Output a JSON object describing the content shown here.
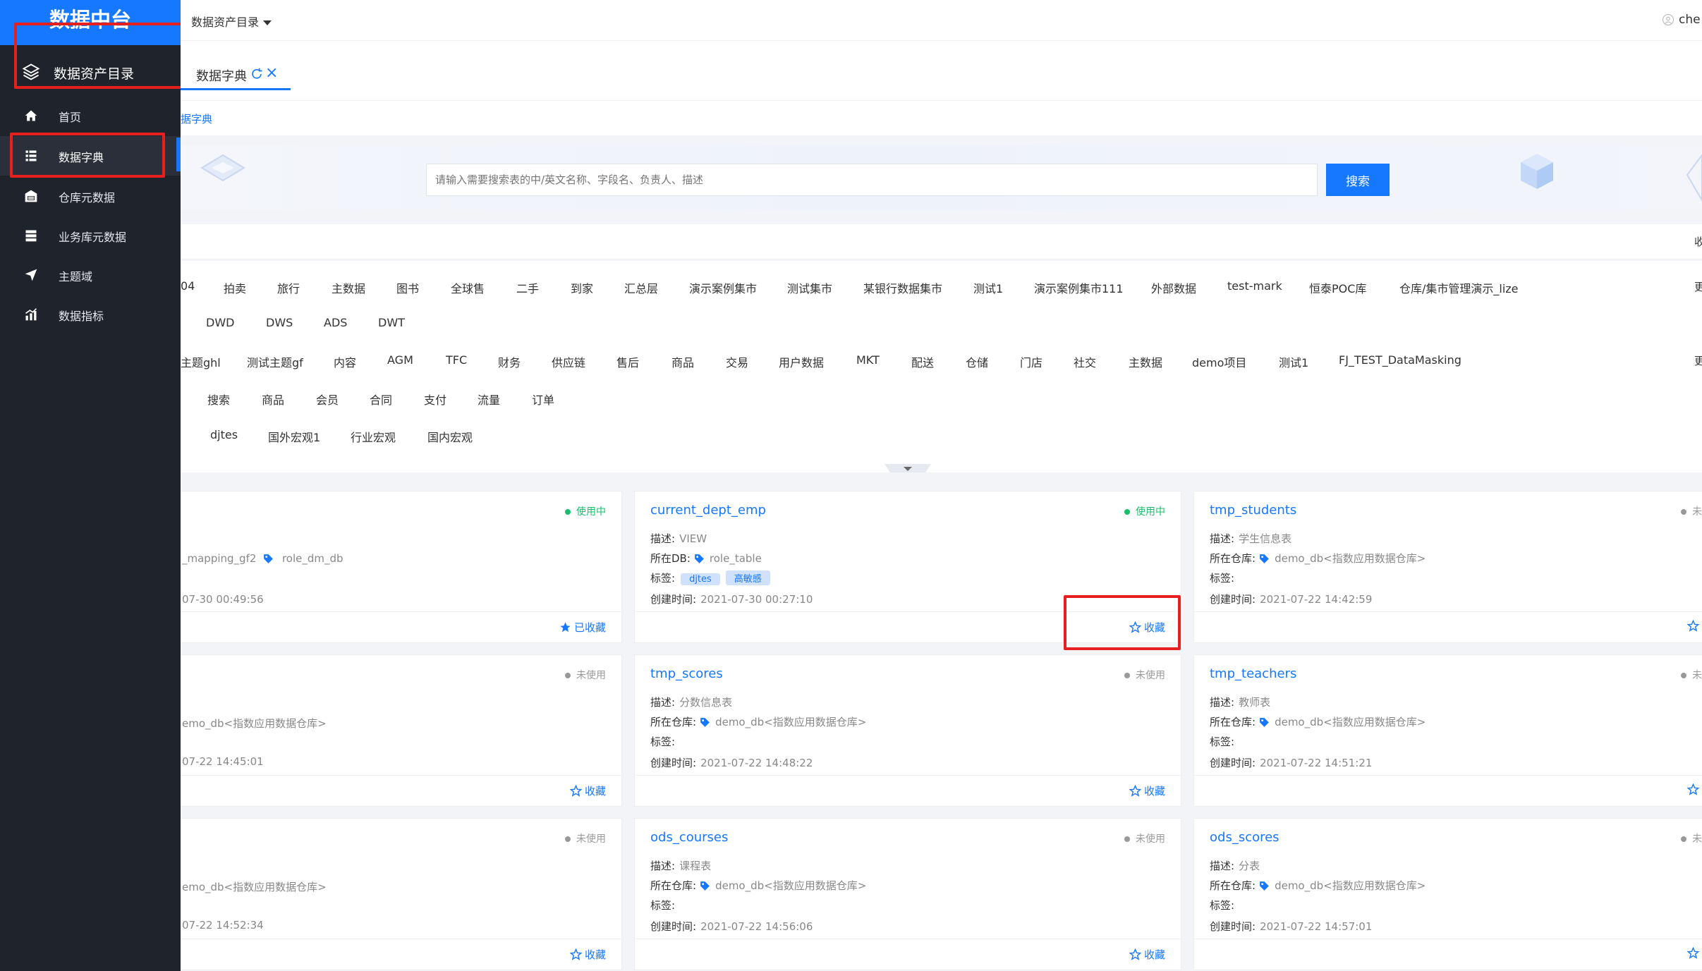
{
  "app": {
    "brand": "数据中台"
  },
  "sidebar": {
    "header_label": "数据资产目录",
    "items": [
      {
        "label": "首页",
        "icon": "home-icon"
      },
      {
        "label": "数据字典",
        "icon": "list-icon"
      },
      {
        "label": "仓库元数据",
        "icon": "warehouse-icon"
      },
      {
        "label": "业务库元数据",
        "icon": "database-icon"
      },
      {
        "label": "主题域",
        "icon": "send-icon"
      },
      {
        "label": "数据指标",
        "icon": "chart-icon"
      }
    ]
  },
  "topbar": {
    "menu_label": "数据资产目录",
    "user": "che"
  },
  "tabs": {
    "active_label": "数据字典"
  },
  "breadcrumb": {
    "current": "据字典"
  },
  "search": {
    "placeholder": "请输入需要搜索表的中/英文名称、字段名、负责人、描述",
    "button": "搜索"
  },
  "filter_head": {
    "right_text": "收"
  },
  "filters": {
    "rows": [
      [
        "04",
        "拍卖",
        "旅行",
        "主数据",
        "图书",
        "全球售",
        "二手",
        "到家",
        "汇总层",
        "演示案例集市",
        "测试集市",
        "某银行数据集市",
        "测试1",
        "演示案例集市111",
        "外部数据",
        "test-mark",
        "恒泰POC库",
        "仓库/集市管理演示_lize"
      ],
      [
        "DWD",
        "DWS",
        "ADS",
        "DWT"
      ],
      [
        "主题ghl",
        "测试主题gf",
        "内容",
        "AGM",
        "TFC",
        "财务",
        "供应链",
        "售后",
        "商品",
        "交易",
        "用户数据",
        "MKT",
        "配送",
        "仓储",
        "门店",
        "社交",
        "主数据",
        "demo项目",
        "测试1",
        "FJ_TEST_DataMasking"
      ],
      [
        "搜索",
        "商品",
        "会员",
        "合同",
        "支付",
        "流量",
        "订单"
      ],
      [
        "djtes",
        "国外宏观1",
        "行业宏观",
        "国内宏观"
      ]
    ],
    "more_label": "更"
  },
  "labels": {
    "desc": "描述:",
    "db": "所在DB:",
    "warehouse": "所在仓库:",
    "tags": "标签:",
    "created": "创建时间:",
    "fav": "收藏",
    "faved": "已收藏",
    "status_in_use": "使用中",
    "status_unused": "未使用",
    "status_unused_clip": "未"
  },
  "cards": [
    {
      "title": "",
      "status": "使用中",
      "desc": "",
      "loc_label": "",
      "loc": "_mapping_gf2",
      "loc2": "role_dm_db",
      "tags": [],
      "created": "07-30 00:49:56",
      "fav": "已收藏"
    },
    {
      "title": "current_dept_emp",
      "status": "使用中",
      "desc": "VIEW",
      "loc_label": "所在DB:",
      "loc": "role_table",
      "tags": [
        "djtes",
        "高敏感"
      ],
      "created": "2021-07-30 00:27:10",
      "fav": "收藏"
    },
    {
      "title": "tmp_students",
      "status": "未",
      "desc": "学生信息表",
      "loc_label": "所在仓库:",
      "loc": "demo_db<指数应用数据仓库>",
      "tags": [],
      "created": "2021-07-22 14:42:59",
      "fav": ""
    },
    {
      "title": "",
      "status": "未使用",
      "desc": "",
      "loc_label": "",
      "loc": "emo_db<指数应用数据仓库>",
      "tags": [],
      "created": "07-22 14:45:01",
      "fav": "收藏"
    },
    {
      "title": "tmp_scores",
      "status": "未使用",
      "desc": "分数信息表",
      "loc_label": "所在仓库:",
      "loc": "demo_db<指数应用数据仓库>",
      "tags": [],
      "created": "2021-07-22 14:48:22",
      "fav": "收藏"
    },
    {
      "title": "tmp_teachers",
      "status": "未",
      "desc": "教师表",
      "loc_label": "所在仓库:",
      "loc": "demo_db<指数应用数据仓库>",
      "tags": [],
      "created": "2021-07-22 14:51:21",
      "fav": ""
    },
    {
      "title": "",
      "status": "未使用",
      "desc": "",
      "loc_label": "",
      "loc": "emo_db<指数应用数据仓库>",
      "tags": [],
      "created": "07-22 14:52:34",
      "fav": "收藏"
    },
    {
      "title": "ods_courses",
      "status": "未使用",
      "desc": "课程表",
      "loc_label": "所在仓库:",
      "loc": "demo_db<指数应用数据仓库>",
      "tags": [],
      "created": "2021-07-22 14:56:06",
      "fav": "收藏"
    },
    {
      "title": "ods_scores",
      "status": "未",
      "desc": "分表",
      "loc_label": "所在仓库:",
      "loc": "demo_db<指数应用数据仓库>",
      "tags": [],
      "created": "2021-07-22 14:57:01",
      "fav": ""
    }
  ],
  "colors": {
    "accent": "#1677ff",
    "sidebar_bg": "#1f232b",
    "highlight_box": "#e61f1f",
    "status_green": "#19be6b"
  }
}
